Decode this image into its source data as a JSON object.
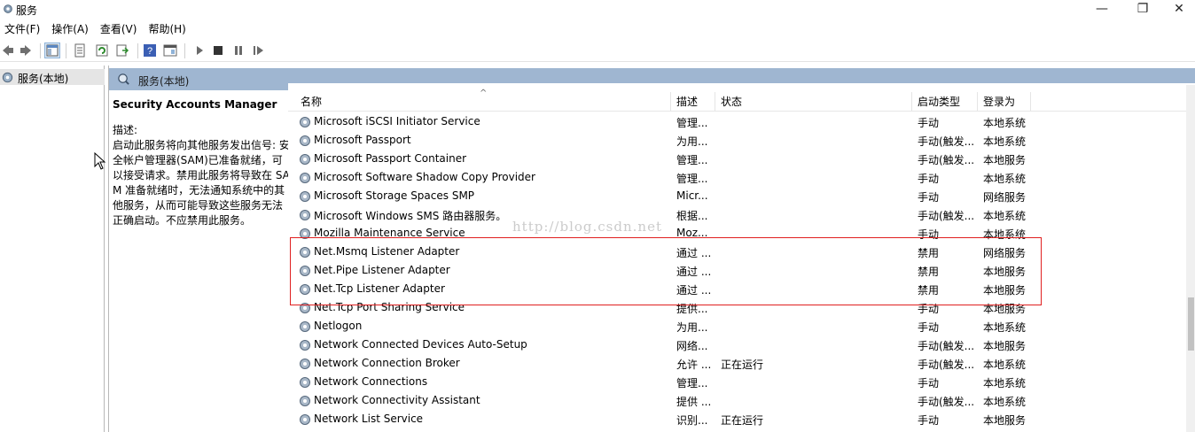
{
  "window": {
    "title": "服务",
    "controls": {
      "minimize": "—",
      "maximize": "❐",
      "close": "✕"
    }
  },
  "menu": [
    "文件(F)",
    "操作(A)",
    "查看(V)",
    "帮助(H)"
  ],
  "toolbar_icons": [
    "back-icon",
    "forward-icon",
    "show-hide-console-tree-icon",
    "properties-icon",
    "refresh-icon",
    "export-list-icon",
    "help-icon",
    "console-view-icon",
    "start-icon",
    "stop-icon",
    "pause-icon",
    "restart-icon"
  ],
  "tree": {
    "selected_label": "服务(本地)"
  },
  "pane": {
    "header_label": "服务(本地)",
    "detail": {
      "service_name": "Security Accounts Manager",
      "description_label": "描述:",
      "description_text": "启动此服务将向其他服务发出信号: 安全帐户管理器(SAM)已准备就绪，可以接受请求。禁用此服务将导致在 SAM 准备就绪时，无法通知系统中的其他服务，从而可能导致这些服务无法正确启动。不应禁用此服务。"
    }
  },
  "list": {
    "columns": {
      "name": "名称",
      "description": "描述",
      "status": "状态",
      "startup": "启动类型",
      "logon": "登录为"
    },
    "rows": [
      {
        "name": "Microsoft iSCSI Initiator Service",
        "description": "管理...",
        "status": "",
        "startup": "手动",
        "logon": "本地系统"
      },
      {
        "name": "Microsoft Passport",
        "description": "为用...",
        "status": "",
        "startup": "手动(触发...",
        "logon": "本地系统"
      },
      {
        "name": "Microsoft Passport Container",
        "description": "管理...",
        "status": "",
        "startup": "手动(触发...",
        "logon": "本地服务"
      },
      {
        "name": "Microsoft Software Shadow Copy Provider",
        "description": "管理...",
        "status": "",
        "startup": "手动",
        "logon": "本地系统"
      },
      {
        "name": "Microsoft Storage Spaces SMP",
        "description": "Micr...",
        "status": "",
        "startup": "手动",
        "logon": "网络服务"
      },
      {
        "name": "Microsoft Windows SMS 路由器服务。",
        "description": "根据...",
        "status": "",
        "startup": "手动(触发...",
        "logon": "本地系统"
      },
      {
        "name": "Mozilla Maintenance Service",
        "description": "Moz...",
        "status": "",
        "startup": "手动",
        "logon": "本地系统"
      },
      {
        "name": "Net.Msmq Listener Adapter",
        "description": "通过 ...",
        "status": "",
        "startup": "禁用",
        "logon": "网络服务"
      },
      {
        "name": "Net.Pipe Listener Adapter",
        "description": "通过 ...",
        "status": "",
        "startup": "禁用",
        "logon": "本地服务"
      },
      {
        "name": "Net.Tcp Listener Adapter",
        "description": "通过 ...",
        "status": "",
        "startup": "禁用",
        "logon": "本地服务"
      },
      {
        "name": "Net.Tcp Port Sharing Service",
        "description": "提供...",
        "status": "",
        "startup": "手动",
        "logon": "本地服务"
      },
      {
        "name": "Netlogon",
        "description": "为用...",
        "status": "",
        "startup": "手动",
        "logon": "本地系统"
      },
      {
        "name": "Network Connected Devices Auto-Setup",
        "description": "网络...",
        "status": "",
        "startup": "手动(触发...",
        "logon": "本地服务"
      },
      {
        "name": "Network Connection Broker",
        "description": "允许 ...",
        "status": "正在运行",
        "startup": "手动(触发...",
        "logon": "本地系统"
      },
      {
        "name": "Network Connections",
        "description": "管理...",
        "status": "",
        "startup": "手动",
        "logon": "本地系统"
      },
      {
        "name": "Network Connectivity Assistant",
        "description": "提供 ...",
        "status": "",
        "startup": "手动(触发...",
        "logon": "本地系统"
      },
      {
        "name": "Network List Service",
        "description": "识别...",
        "status": "正在运行",
        "startup": "手动",
        "logon": "本地服务"
      }
    ]
  },
  "watermark": "http://blog.csdn.net",
  "colors": {
    "pane_header": "#9fb6d1",
    "highlight_border": "#e02020",
    "tree_selected": "#e5e5e5"
  }
}
